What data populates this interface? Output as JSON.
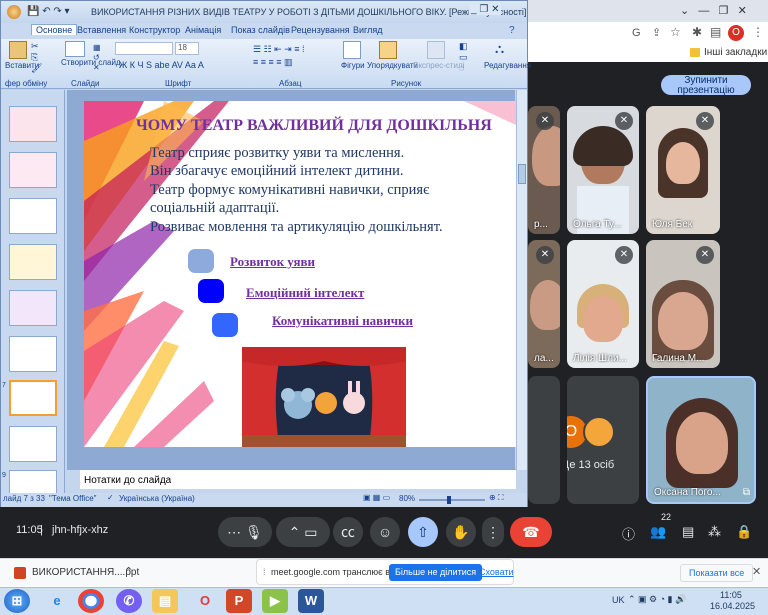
{
  "ppt": {
    "title": "ВИКОРИСТАННЯ РІЗНИХ ВИДІВ ТЕАТРУ У РОБОТІ З ДІТЬМИ ДОШКІЛЬНОГО ВІКУ. [Режим сумісності] - M...",
    "tabs": [
      "Основне",
      "Вставлення",
      "Конструктор",
      "Анімація",
      "Показ слайдів",
      "Рецензування",
      "Вигляд"
    ],
    "ribbon": {
      "paste": "Вставити",
      "new_slide": "Створити слайд",
      "clipboard": "фер обміну",
      "slides": "Слайди",
      "font": "Шрифт",
      "paragraph": "Абзац",
      "figures": "Фігури",
      "arrange": "Упорядкувати",
      "express": "Експрес-стилі",
      "drawing": "Рисунок",
      "editing": "Редагування",
      "font_size": "18"
    },
    "thumb_numbers": [
      "",
      "",
      "",
      "",
      "",
      "",
      "7",
      "",
      "9"
    ],
    "notes_placeholder": "Нотатки до слайда",
    "status": {
      "slide": "лайд 7 з 33",
      "theme": "\"Тема Office\"",
      "language": "Українська (Україна)",
      "zoom": "80%"
    }
  },
  "slide": {
    "title": "ЧОМУ ТЕАТР ВАЖЛИВИЙ ДЛЯ ДОШКІЛЬНЯ",
    "lines": [
      "Театр сприяє розвитку уяви та мислення.",
      " Він збагачує емоційний інтелект дитини.",
      "Театр формує комунікативні навички, сприяє",
      "соціальній адаптації.",
      "Розвиває мовлення та артикуляцію дошкільнят."
    ],
    "bullets": [
      "Розвиток уяви",
      "Емоційний інтелект",
      "Комунікативні навички"
    ],
    "bullet_colors": [
      "#8ea9db",
      "#0000ff",
      "#3366ff"
    ]
  },
  "chrome": {
    "bookmarks": "Інші закладки",
    "avatar_letter": "O"
  },
  "meet": {
    "stop_present": "Зупинити презентацію",
    "participants": [
      {
        "name": "р..."
      },
      {
        "name": "Ольга Ту..."
      },
      {
        "name": "Юля Бек"
      },
      {
        "name": "ла..."
      },
      {
        "name": "Лілія Шли..."
      },
      {
        "name": "Галина М..."
      },
      {
        "name": "Оксана Пого..."
      }
    ],
    "others_label": "Ще 13 осіб",
    "others_avatar": "O",
    "time": "11:05",
    "meeting_code": "jhn-hfjx-xhz",
    "people_count": "22"
  },
  "download": {
    "file": "ВИКОРИСТАННЯ....ppt",
    "share_text": "meet.google.com транслює вікно.",
    "stop_share": "Більше не ділитися",
    "hide": "Сховати",
    "show_all": "Показати все"
  },
  "taskbar": {
    "lang": "UK",
    "time": "11:05",
    "date": "16.04.2025"
  }
}
